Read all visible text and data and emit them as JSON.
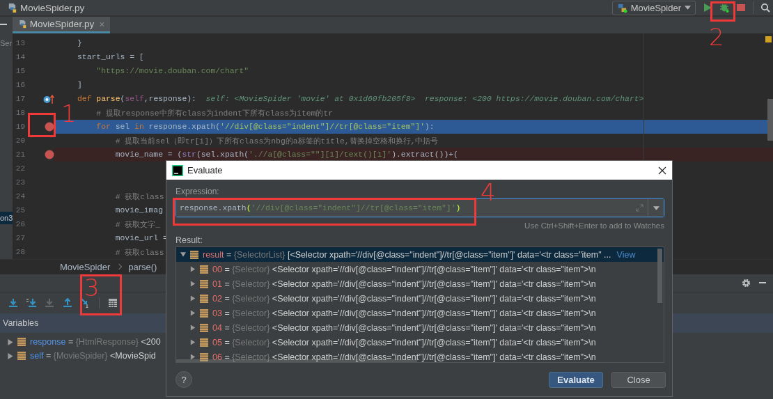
{
  "navbar": {
    "file": "MovieSpider.py",
    "run_config": "MovieSpider"
  },
  "tab": {
    "label": "MovieSpider.py",
    "selected": true
  },
  "left_panel": [
    "Ser",
    "on3"
  ],
  "editor": {
    "lines": [
      {
        "number": "13",
        "breakpoint": false,
        "current": false,
        "override_marker": false,
        "code": [
          {
            "text": "}",
            "kind": "plain"
          }
        ]
      },
      {
        "number": "14",
        "breakpoint": false,
        "current": false,
        "override_marker": false,
        "code": [
          {
            "text": "start_urls = [",
            "kind": "plain"
          }
        ]
      },
      {
        "number": "15",
        "breakpoint": false,
        "current": false,
        "override_marker": false,
        "code": [
          {
            "text": "    \"https://movie.douban.com/chart\"",
            "kind": "str"
          }
        ]
      },
      {
        "number": "16",
        "breakpoint": false,
        "current": false,
        "override_marker": false,
        "code": [
          {
            "text": "]",
            "kind": "plain"
          }
        ]
      },
      {
        "number": "17",
        "breakpoint": false,
        "current": false,
        "override_marker": true,
        "code": [
          {
            "text": "def",
            "kind": "kw"
          },
          {
            "text": " parse",
            "kind": "fn"
          },
          {
            "text": "(",
            "kind": "plain"
          },
          {
            "text": "self",
            "kind": "self"
          },
          {
            "text": ",response):",
            "kind": "plain"
          },
          {
            "text": "  self: <MovieSpider 'movie' at 0x1d60fb205f8>  response: <200 https://movie.douban.com/chart>",
            "kind": "hint"
          }
        ]
      },
      {
        "number": "18",
        "breakpoint": false,
        "current": false,
        "override_marker": false,
        "code": [
          {
            "text": "    # 提取response中所有class为indent下所有class为item的tr",
            "kind": "com"
          }
        ]
      },
      {
        "number": "19",
        "breakpoint": true,
        "current": true,
        "override_marker": false,
        "code": [
          {
            "text": "    for",
            "kind": "kw"
          },
          {
            "text": " sel ",
            "kind": "plain"
          },
          {
            "text": "in",
            "kind": "kw"
          },
          {
            "text": " response.xpath(",
            "kind": "plain"
          },
          {
            "text": "'//div[@class=\"indent\"]//tr[@class=\"item\"]'",
            "kind": "str"
          },
          {
            "text": "):",
            "kind": "plain"
          }
        ]
      },
      {
        "number": "20",
        "breakpoint": false,
        "current": false,
        "override_marker": false,
        "code": [
          {
            "text": "        # 提取当前sel（即tr[i]）下所有class为nbg的a标签的title,替换掉空格和换行,中括号",
            "kind": "com"
          }
        ]
      },
      {
        "number": "21",
        "breakpoint": true,
        "current": false,
        "override_marker": false,
        "code": [
          {
            "text": "        movie_name = (",
            "kind": "plain"
          },
          {
            "text": "str",
            "kind": "bi"
          },
          {
            "text": "(sel.xpath(",
            "kind": "plain"
          },
          {
            "text": "'.//a[@class=\"\"][1]/text()[1]'",
            "kind": "str"
          },
          {
            "text": ").extract())+(",
            "kind": "plain"
          }
        ]
      },
      {
        "number": "22",
        "breakpoint": false,
        "current": false,
        "override_marker": false
      },
      {
        "number": "23",
        "breakpoint": false,
        "current": false,
        "override_marker": false
      },
      {
        "number": "24",
        "breakpoint": false,
        "current": false,
        "override_marker": false,
        "code": [
          {
            "text": "        # 获取class",
            "kind": "com"
          }
        ]
      },
      {
        "number": "25",
        "breakpoint": false,
        "current": false,
        "override_marker": false,
        "code": [
          {
            "text": "        movie_imag",
            "kind": "plain"
          }
        ]
      },
      {
        "number": "26",
        "breakpoint": false,
        "current": false,
        "override_marker": false,
        "code": [
          {
            "text": "        # 获取文字_",
            "kind": "com"
          }
        ]
      },
      {
        "number": "27",
        "breakpoint": false,
        "current": false,
        "override_marker": false,
        "code": [
          {
            "text": "        movie_url =",
            "kind": "plain"
          }
        ]
      },
      {
        "number": "28",
        "breakpoint": false,
        "current": false,
        "override_marker": false,
        "code": [
          {
            "text": "        # 获取class",
            "kind": "com"
          }
        ]
      }
    ]
  },
  "breadcrumbs": [
    "MovieSpider",
    "parse()"
  ],
  "debug": {
    "variables_title": "Variables",
    "variables": [
      {
        "name": "response",
        "assign": "=",
        "type": "{HtmlResponse}",
        "value": "<200"
      },
      {
        "name": "self",
        "assign": "=",
        "type": "{MovieSpider}",
        "value": "<MovieSpid"
      }
    ]
  },
  "dialog": {
    "title": "Evaluate",
    "expression_label": "Expression:",
    "expression": [
      {
        "text": "response.xpath",
        "kind": "plain"
      },
      {
        "text": "(",
        "kind": "brace"
      },
      {
        "text": "'//div[@class=\"indent\"]//tr[@class=\"item\"]'",
        "kind": "str"
      },
      {
        "text": ")",
        "kind": "brace"
      }
    ],
    "hint": "Use Ctrl+Shift+Enter to add to Watches",
    "result_label": "Result:",
    "result": {
      "name": "result",
      "assign": "=",
      "type": "{SelectorList}",
      "value": "[<Selector xpath='//div[@class=\"indent\"]//tr[@class=\"item\"]' data='<tr class=\"item\" ...",
      "link": "View",
      "expanded": true,
      "selected": true,
      "children": [
        {
          "name": "00",
          "assign": "=",
          "type": "{Selector}",
          "value": "<Selector xpath='//div[@class=\"indent\"]//tr[@class=\"item\"]' data='<tr class=\"item\">\\n",
          "expanded": false,
          "selected": false
        },
        {
          "name": "01",
          "assign": "=",
          "type": "{Selector}",
          "value": "<Selector xpath='//div[@class=\"indent\"]//tr[@class=\"item\"]' data='<tr class=\"item\">\\n",
          "expanded": false,
          "selected": false
        },
        {
          "name": "02",
          "assign": "=",
          "type": "{Selector}",
          "value": "<Selector xpath='//div[@class=\"indent\"]//tr[@class=\"item\"]' data='<tr class=\"item\">\\n",
          "expanded": false,
          "selected": false
        },
        {
          "name": "03",
          "assign": "=",
          "type": "{Selector}",
          "value": "<Selector xpath='//div[@class=\"indent\"]//tr[@class=\"item\"]' data='<tr class=\"item\">\\n",
          "expanded": false,
          "selected": false
        },
        {
          "name": "04",
          "assign": "=",
          "type": "{Selector}",
          "value": "<Selector xpath='//div[@class=\"indent\"]//tr[@class=\"item\"]' data='<tr class=\"item\">\\n",
          "expanded": false,
          "selected": false
        },
        {
          "name": "05",
          "assign": "=",
          "type": "{Selector}",
          "value": "<Selector xpath='//div[@class=\"indent\"]//tr[@class=\"item\"]' data='<tr class=\"item\">\\n",
          "expanded": false,
          "selected": false
        },
        {
          "name": "06",
          "assign": "=",
          "type": "{Selector}",
          "value": "<Selector xpath='//div[@class=\"indent\"]//tr[@class=\"item\"]' data='<tr class=\"item\">\\n",
          "expanded": false,
          "selected": false
        }
      ]
    },
    "help": "?",
    "buttons": [
      {
        "label": "Evaluate",
        "primary": true
      },
      {
        "label": "Close",
        "primary": false
      }
    ]
  },
  "annotations": [
    {
      "label": "1"
    },
    {
      "label": "2"
    },
    {
      "label": "3"
    },
    {
      "label": "4"
    }
  ]
}
